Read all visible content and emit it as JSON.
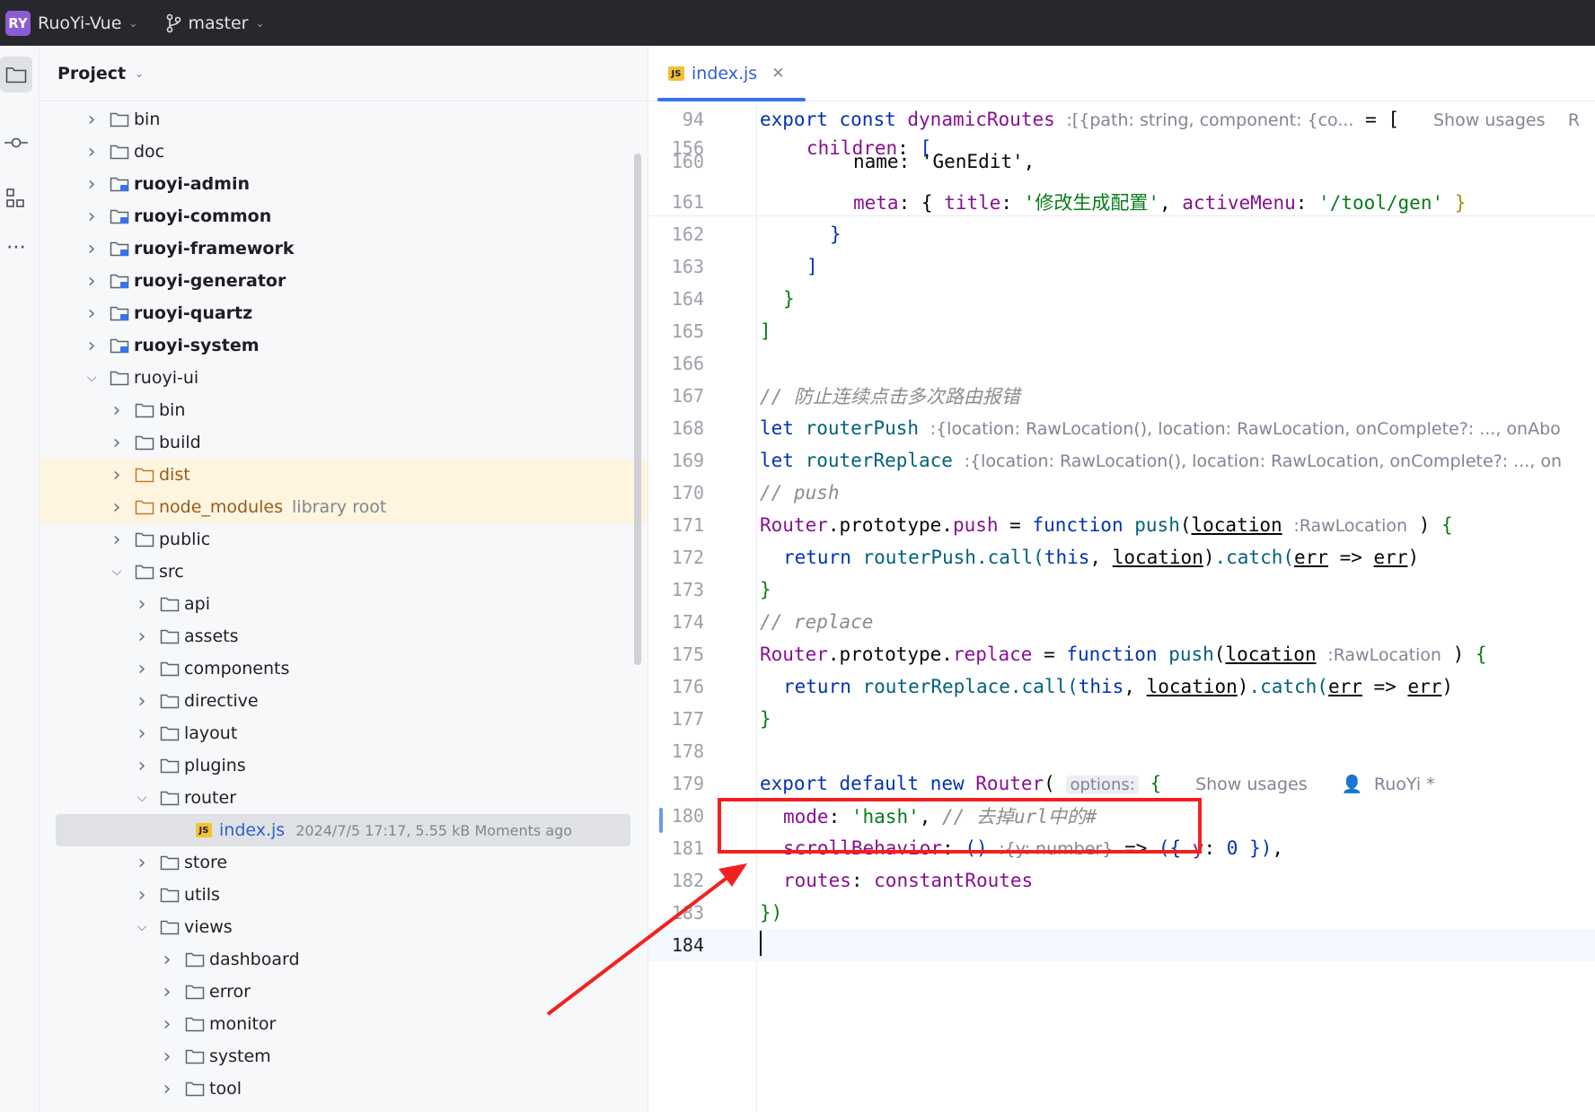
{
  "topbar": {
    "badge": "RY",
    "project": "RuoYi-Vue",
    "branch": "master"
  },
  "panel": {
    "title": "Project"
  },
  "tree": [
    {
      "label": "bin",
      "depth": 0,
      "expanded": false,
      "bold": false
    },
    {
      "label": "doc",
      "depth": 0,
      "expanded": false,
      "bold": false
    },
    {
      "label": "ruoyi-admin",
      "depth": 0,
      "expanded": false,
      "bold": true,
      "module": true
    },
    {
      "label": "ruoyi-common",
      "depth": 0,
      "expanded": false,
      "bold": true,
      "module": true
    },
    {
      "label": "ruoyi-framework",
      "depth": 0,
      "expanded": false,
      "bold": true,
      "module": true
    },
    {
      "label": "ruoyi-generator",
      "depth": 0,
      "expanded": false,
      "bold": true,
      "module": true
    },
    {
      "label": "ruoyi-quartz",
      "depth": 0,
      "expanded": false,
      "bold": true,
      "module": true
    },
    {
      "label": "ruoyi-system",
      "depth": 0,
      "expanded": false,
      "bold": true,
      "module": true
    },
    {
      "label": "ruoyi-ui",
      "depth": 0,
      "expanded": true,
      "bold": false
    },
    {
      "label": "bin",
      "depth": 1,
      "expanded": false
    },
    {
      "label": "build",
      "depth": 1,
      "expanded": false
    },
    {
      "label": "dist",
      "depth": 1,
      "expanded": false,
      "excluded": true
    },
    {
      "label": "node_modules",
      "depth": 1,
      "expanded": false,
      "excluded": true,
      "note": "library root"
    },
    {
      "label": "public",
      "depth": 1,
      "expanded": false
    },
    {
      "label": "src",
      "depth": 1,
      "expanded": true
    },
    {
      "label": "api",
      "depth": 2,
      "expanded": false
    },
    {
      "label": "assets",
      "depth": 2,
      "expanded": false
    },
    {
      "label": "components",
      "depth": 2,
      "expanded": false
    },
    {
      "label": "directive",
      "depth": 2,
      "expanded": false
    },
    {
      "label": "layout",
      "depth": 2,
      "expanded": false
    },
    {
      "label": "plugins",
      "depth": 2,
      "expanded": false
    },
    {
      "label": "router",
      "depth": 2,
      "expanded": true
    },
    {
      "label": "index.js",
      "depth": 3,
      "file": true,
      "selected": true,
      "meta": "2024/7/5 17:17, 5.55 kB Moments ago"
    },
    {
      "label": "store",
      "depth": 2,
      "expanded": false
    },
    {
      "label": "utils",
      "depth": 2,
      "expanded": false
    },
    {
      "label": "views",
      "depth": 2,
      "expanded": true
    },
    {
      "label": "dashboard",
      "depth": 3,
      "expanded": false
    },
    {
      "label": "error",
      "depth": 3,
      "expanded": false
    },
    {
      "label": "monitor",
      "depth": 3,
      "expanded": false
    },
    {
      "label": "system",
      "depth": 3,
      "expanded": false
    },
    {
      "label": "tool",
      "depth": 3,
      "expanded": false
    }
  ],
  "editor": {
    "tab": "index.js",
    "js_badge": "JS",
    "sticky": [
      {
        "n": "94",
        "kw1": "export",
        "kw2": "const",
        "name": "dynamicRoutes",
        "hint": ":[{path: string, component: {co...",
        "eq": " = [",
        "usages": "Show usages",
        "author": "R"
      },
      {
        "n": "156",
        "text": "children: ["
      }
    ],
    "lines": [
      {
        "n": "160",
        "html": "name_genedit"
      },
      {
        "n": "161"
      },
      {
        "n": "162"
      },
      {
        "n": "163"
      },
      {
        "n": "164"
      },
      {
        "n": "165"
      },
      {
        "n": "166"
      },
      {
        "n": "167"
      },
      {
        "n": "168"
      },
      {
        "n": "169"
      },
      {
        "n": "170"
      },
      {
        "n": "171"
      },
      {
        "n": "172"
      },
      {
        "n": "173"
      },
      {
        "n": "174"
      },
      {
        "n": "175"
      },
      {
        "n": "176"
      },
      {
        "n": "177"
      },
      {
        "n": "178"
      },
      {
        "n": "179"
      },
      {
        "n": "180"
      },
      {
        "n": "181"
      },
      {
        "n": "182"
      },
      {
        "n": "183"
      },
      {
        "n": "184"
      }
    ],
    "text": {
      "l160": "name: 'GenEdit',",
      "meta_kw": "meta",
      "title_kw": "title",
      "title_val": "'修改生成配置'",
      "active_kw": "activeMenu",
      "active_val": "'/tool/gen'",
      "c167": "// 防止连续点击多次路由报错",
      "let": "let",
      "routerPush": "routerPush",
      "routerReplace": "routerReplace",
      "hint168": ":{location: RawLocation(), location: RawLocation, onComplete?: ..., onAbo",
      "hint169": ":{location: RawLocation(), location: RawLocation, onComplete?: ..., on",
      "c170": "// push",
      "router": "Router",
      "prototype": ".prototype.",
      "push": "push",
      "replace": "replace",
      "function": "function",
      "location": "location",
      "hintloc": ":RawLocation",
      "return": "return",
      "call": ".call(",
      "this": "this",
      "catch": ".catch(",
      "err": "err",
      "c174": "// replace",
      "export": "export",
      "default": "default",
      "new": "new",
      "options_hint": "options:",
      "usages": "Show usages",
      "author": "RuoYi *",
      "mode_kw": "mode",
      "hash_val": "'hash'",
      "c180": "// 去掉url中的#",
      "scroll_kw": "scrollBehavior",
      "scroll_hint": ":{y: number}",
      "zero": "0",
      "y": "y",
      "routes_kw": "routes",
      "constant": "constantRoutes"
    }
  },
  "colors": {
    "annotation": "#f2211f",
    "accent": "#3574f0"
  }
}
